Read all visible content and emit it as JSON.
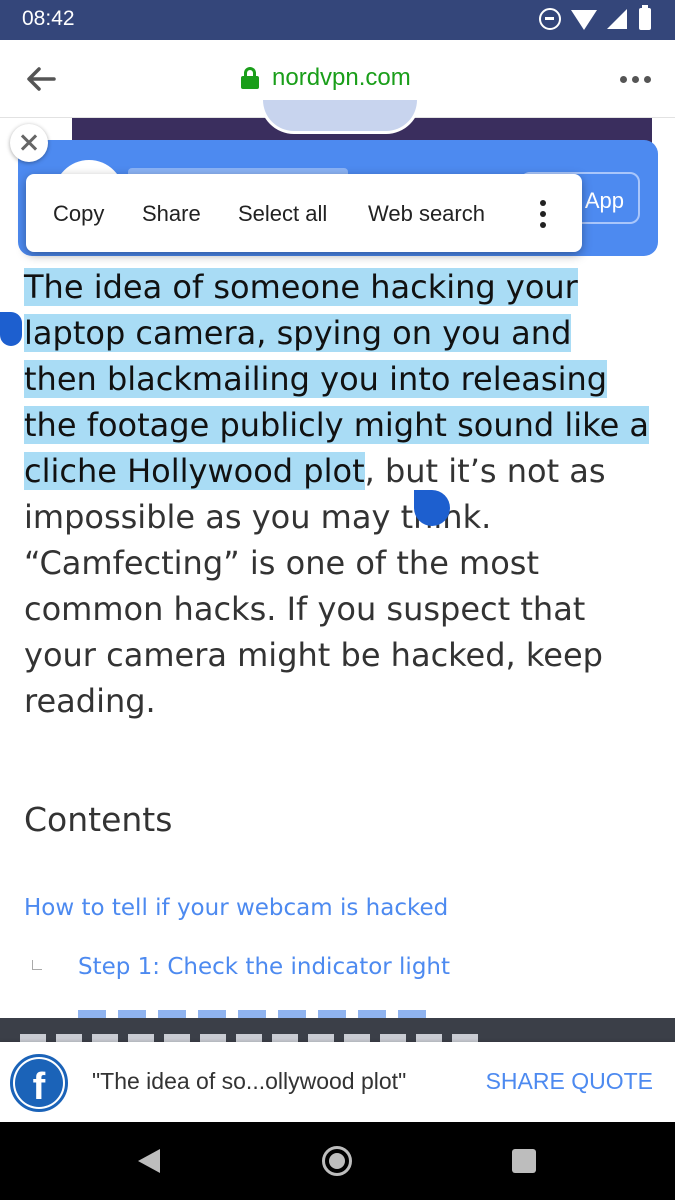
{
  "status_bar": {
    "time": "08:42",
    "icons": [
      "do-not-disturb-icon",
      "wifi-icon",
      "signal-icon",
      "battery-icon"
    ]
  },
  "browser": {
    "url": "nordvpn.com",
    "secure": true,
    "accent_color": "#1a9e1a"
  },
  "app_banner": {
    "button_label": "App",
    "color": "#4d8af0"
  },
  "selection_menu": {
    "items": [
      "Copy",
      "Share",
      "Select all",
      "Web search"
    ]
  },
  "article": {
    "selected_text": "The idea of someone hacking your laptop camera, spying on you and then blackmailing you into releasing the footage publicly might sound like a cliche Hollywood plot",
    "rest_text": ", but it’s not as impossible as you may think. “Camfecting” is one of the most common hacks. If you suspect that your camera might be hacked, keep reading.",
    "selection_color": "#a9dcf5"
  },
  "contents": {
    "title": "Contents",
    "items": [
      "How to tell if your webcam is hacked",
      "Step 1: Check the indicator light"
    ]
  },
  "share_bar": {
    "quote": "\"The idea of so...ollywood plot\"",
    "action": "SHARE QUOTE"
  }
}
